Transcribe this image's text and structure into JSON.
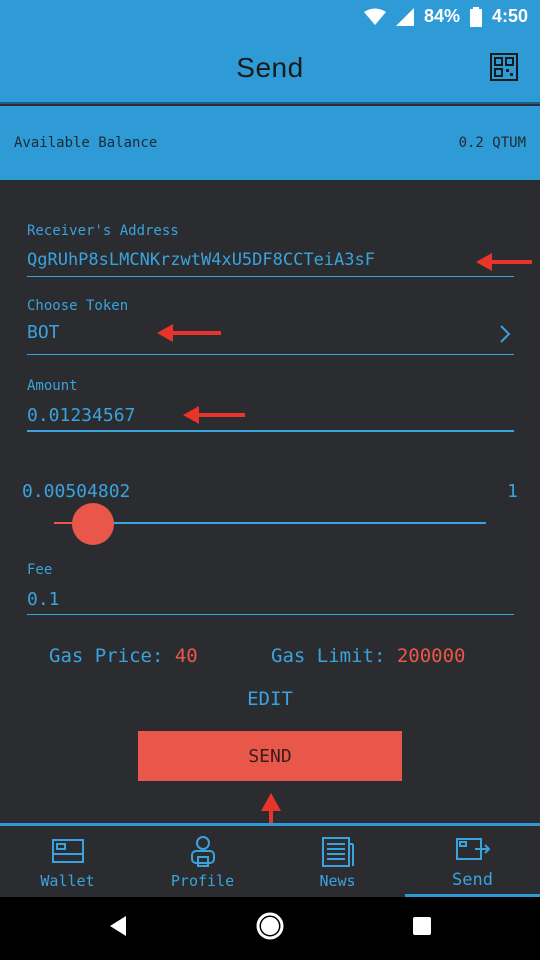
{
  "status": {
    "battery": "84%",
    "time": "4:50"
  },
  "appbar": {
    "title": "Send"
  },
  "balance": {
    "label": "Available Balance",
    "value": "0.2 QTUM"
  },
  "receiver": {
    "label": "Receiver's Address",
    "value": "QgRUhP8sLMCNKrzwtW4xU5DF8CCTeiA3sF"
  },
  "token": {
    "label": "Choose Token",
    "value": "BOT"
  },
  "amount": {
    "label": "Amount",
    "value": "0.01234567"
  },
  "slider": {
    "min_label": "0.00504802",
    "max_label": "1",
    "level": 0.09
  },
  "fee": {
    "label": "Fee",
    "value": "0.1"
  },
  "gas": {
    "price_label": "Gas Price:",
    "price_value": "40",
    "limit_label": "Gas Limit:",
    "limit_value": "200000"
  },
  "actions": {
    "edit_label": "EDIT",
    "send_label": "SEND"
  },
  "nav": [
    {
      "label": "Wallet",
      "icon": "wallet-icon"
    },
    {
      "label": "Profile",
      "icon": "profile-icon"
    },
    {
      "label": "News",
      "icon": "news-icon"
    },
    {
      "label": "Send",
      "icon": "send-icon"
    }
  ],
  "colors": {
    "accent": "#2e9bd6",
    "text_blue": "#3aa3dd",
    "red": "#e8574a",
    "background": "#2b2c30"
  }
}
